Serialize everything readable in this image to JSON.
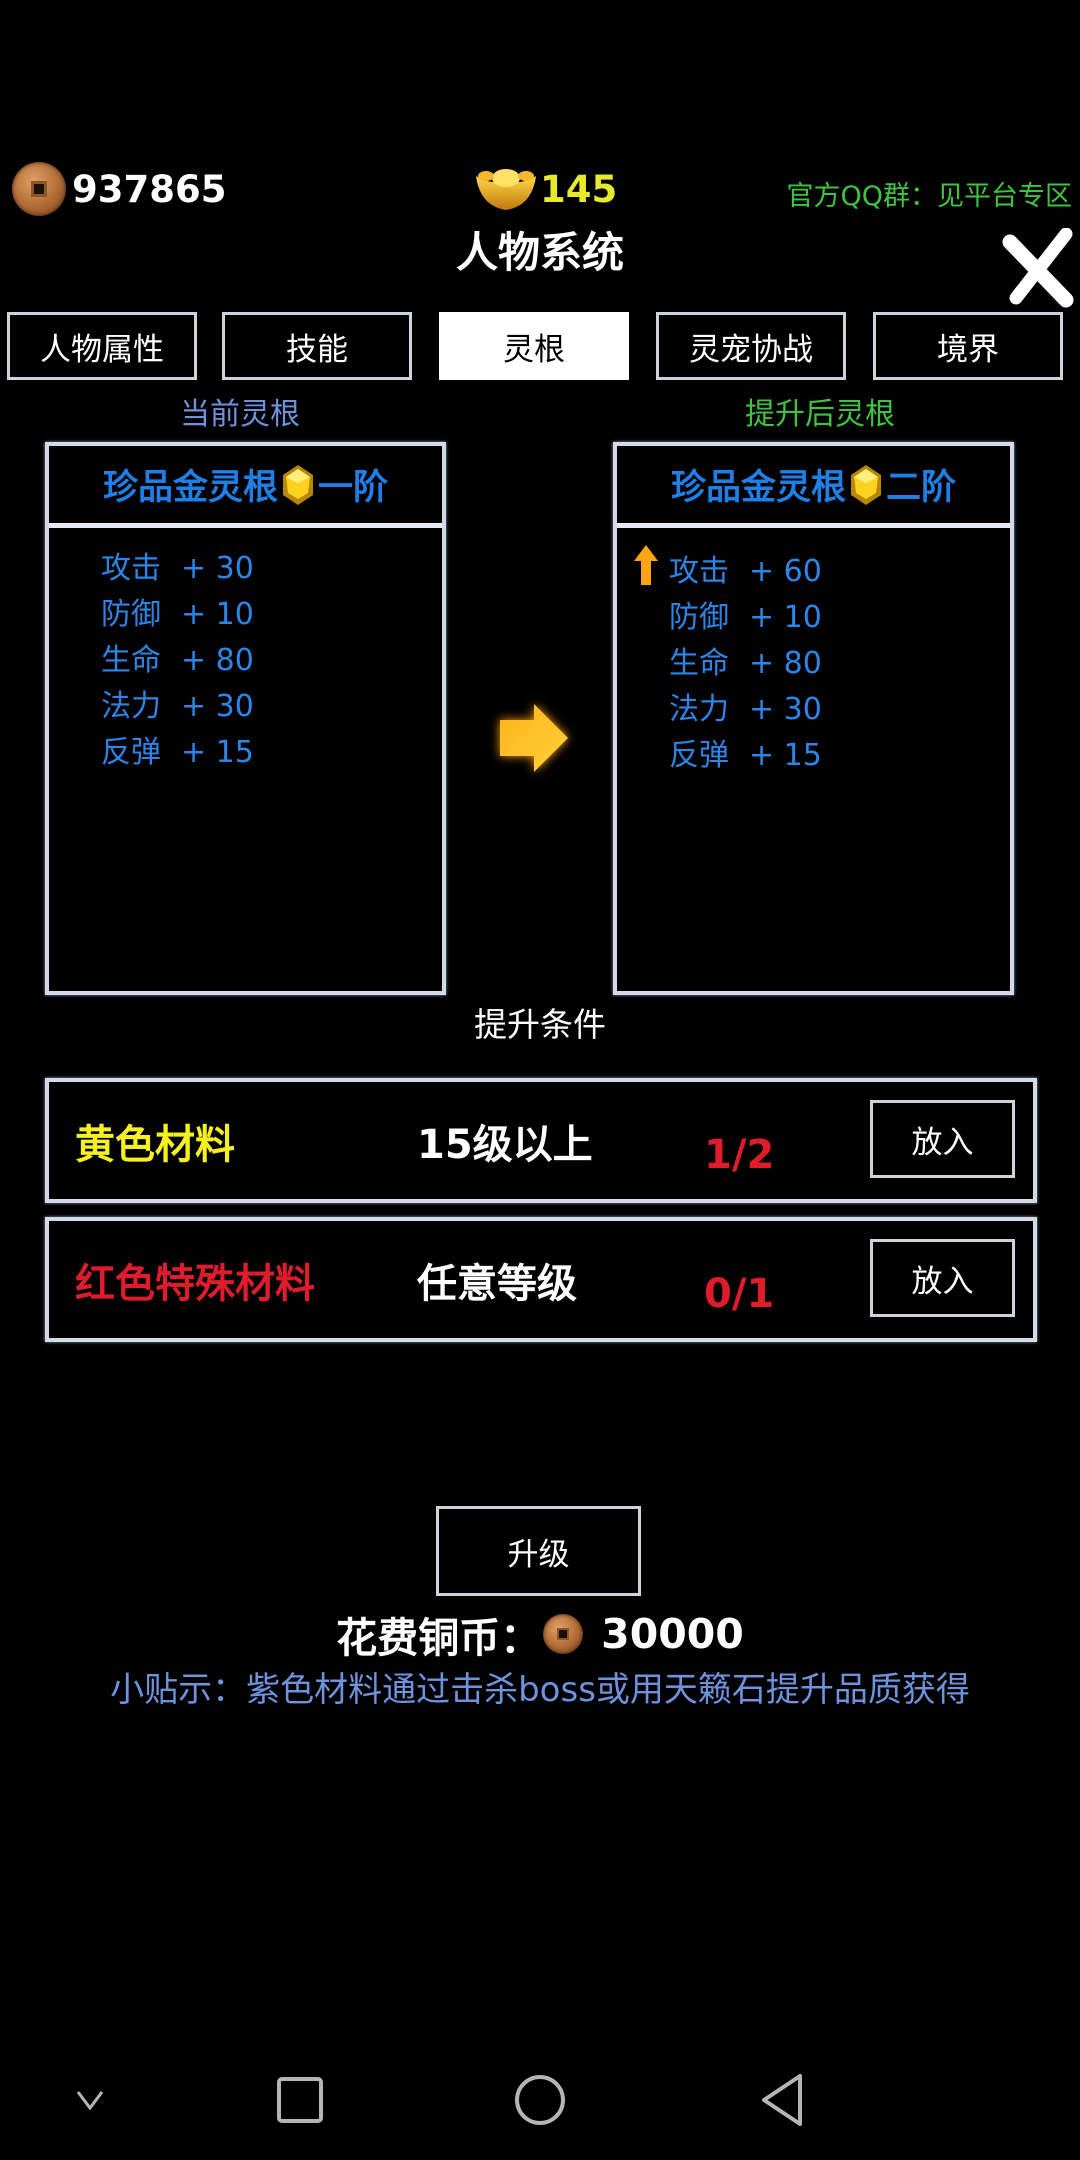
{
  "top_bar": {
    "copper_coins": "937865",
    "gold_ingots": "145",
    "qq_group_text": "官方QQ群：见平台专区"
  },
  "title": "人物系统",
  "tabs": [
    {
      "label": "人物属性",
      "active": false
    },
    {
      "label": "技能",
      "active": false
    },
    {
      "label": "灵根",
      "active": true
    },
    {
      "label": "灵宠协战",
      "active": false
    },
    {
      "label": "境界",
      "active": false
    }
  ],
  "current_root": {
    "section_label": "当前灵根",
    "name": "珍品金灵根",
    "tier": "一阶",
    "stats": [
      {
        "name": "攻击",
        "value": "+ 30"
      },
      {
        "name": "防御",
        "value": "+ 10"
      },
      {
        "name": "生命",
        "value": "+ 80"
      },
      {
        "name": "法力",
        "value": "+ 30"
      },
      {
        "name": "反弹",
        "value": "+ 15"
      }
    ]
  },
  "upgraded_root": {
    "section_label": "提升后灵根",
    "name": "珍品金灵根",
    "tier": "二阶",
    "stats": [
      {
        "name": "攻击",
        "value": "+ 60",
        "increased": true
      },
      {
        "name": "防御",
        "value": "+ 10",
        "increased": false
      },
      {
        "name": "生命",
        "value": "+ 80",
        "increased": false
      },
      {
        "name": "法力",
        "value": "+ 30",
        "increased": false
      },
      {
        "name": "反弹",
        "value": "+ 15",
        "increased": false
      }
    ]
  },
  "conditions": {
    "title": "提升条件",
    "rows": [
      {
        "material": "黄色材料",
        "material_color": "#f5f01e",
        "requirement": "15级以上",
        "count": "1/2",
        "button": "放入"
      },
      {
        "material": "红色特殊材料",
        "material_color": "#e01c2c",
        "requirement": "任意等级",
        "count": "0/1",
        "button": "放入"
      }
    ]
  },
  "upgrade": {
    "button": "升级",
    "cost_label": "花费铜币：",
    "cost_value": "30000"
  },
  "tip": "小贴示：紫色材料通过击杀boss或用天籁石提升品质获得",
  "colors": {
    "stat_blue": "#2b86e8",
    "header_blue": "#1e7fe6",
    "qq_green": "#3fc43f",
    "ingot_yellow": "#e6ea2a",
    "count_red": "#e01c2c",
    "tip_blue": "#6e92dc"
  },
  "nav_bar": [
    "chevron-down",
    "recent-apps",
    "home",
    "back"
  ]
}
